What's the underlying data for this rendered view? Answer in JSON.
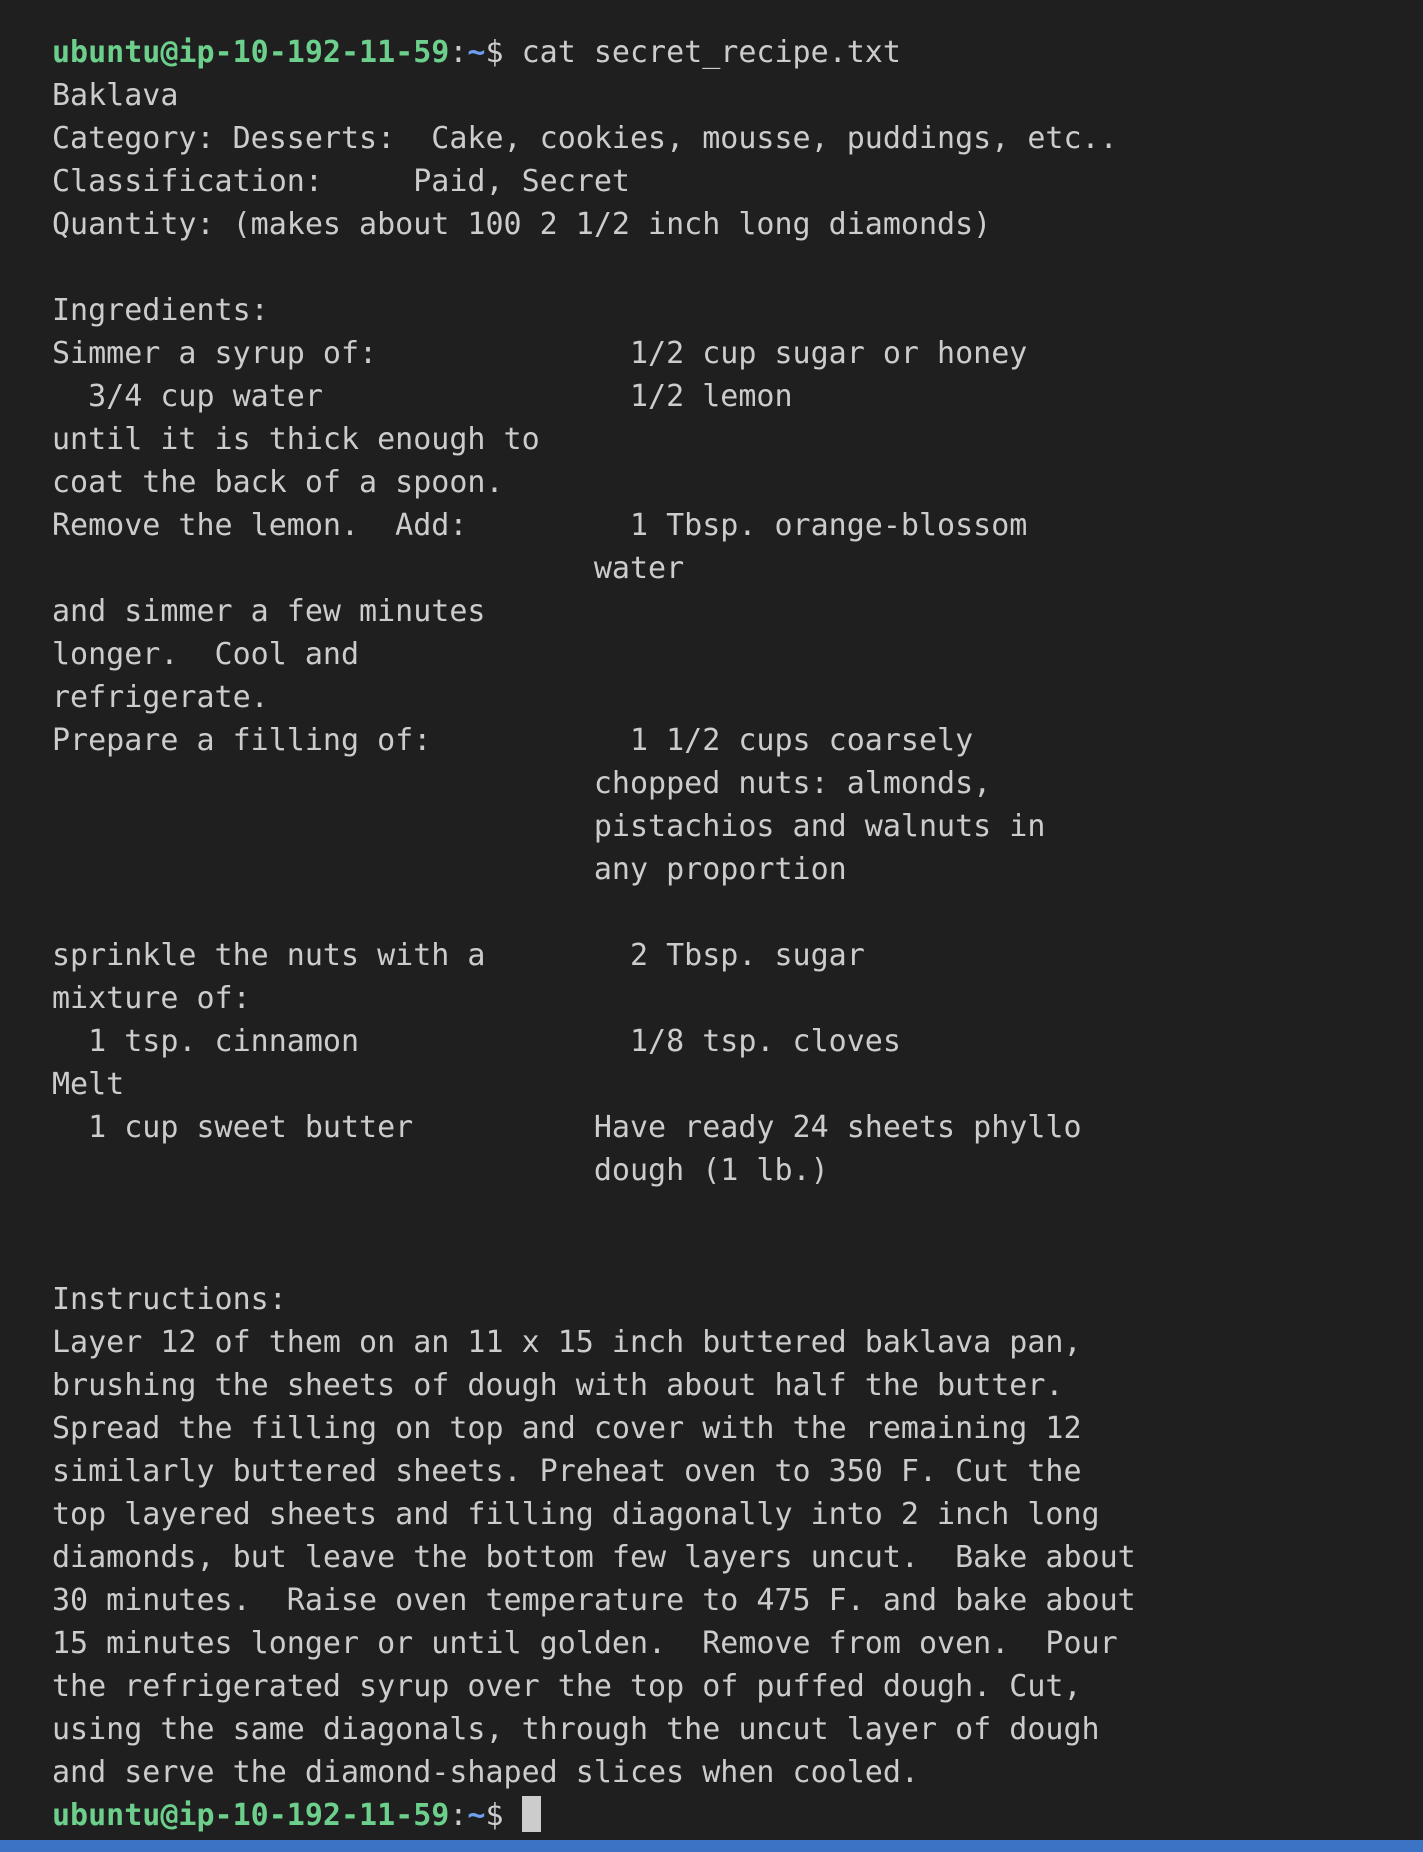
{
  "prompt": {
    "user_host": "ubuntu@ip-10-192-11-59",
    "separator": ":",
    "path": "~",
    "symbol": "$ "
  },
  "command": "cat secret_recipe.txt",
  "output_lines": [
    "Baklava",
    "Category: Desserts:  Cake, cookies, mousse, puddings, etc..",
    "Classification:     Paid, Secret",
    "Quantity: (makes about 100 2 1/2 inch long diamonds)",
    "",
    "Ingredients:",
    "Simmer a syrup of:              1/2 cup sugar or honey",
    "  3/4 cup water                 1/2 lemon",
    "until it is thick enough to",
    "coat the back of a spoon.",
    "Remove the lemon.  Add:         1 Tbsp. orange-blossom",
    "                              water",
    "and simmer a few minutes",
    "longer.  Cool and",
    "refrigerate.",
    "Prepare a filling of:           1 1/2 cups coarsely",
    "                              chopped nuts: almonds,",
    "                              pistachios and walnuts in",
    "                              any proportion",
    "",
    "sprinkle the nuts with a        2 Tbsp. sugar",
    "mixture of:",
    "  1 tsp. cinnamon               1/8 tsp. cloves",
    "Melt",
    "  1 cup sweet butter          Have ready 24 sheets phyllo",
    "                              dough (1 lb.)",
    "",
    "",
    "Instructions:",
    "Layer 12 of them on an 11 x 15 inch buttered baklava pan,",
    "brushing the sheets of dough with about half the butter.",
    "Spread the filling on top and cover with the remaining 12",
    "similarly buttered sheets. Preheat oven to 350 F. Cut the",
    "top layered sheets and filling diagonally into 2 inch long",
    "diamonds, but leave the bottom few layers uncut.  Bake about",
    "30 minutes.  Raise oven temperature to 475 F. and bake about",
    "15 minutes longer or until golden.  Remove from oven.  Pour",
    "the refrigerated syrup over the top of puffed dough. Cut,",
    "using the same diagonals, through the uncut layer of dough",
    "and serve the diamond-shaped slices when cooled."
  ],
  "colors": {
    "background": "#1f1f1f",
    "text": "#cccccc",
    "prompt_user": "#6ccf8b",
    "prompt_path": "#6f9ff0",
    "status_bar": "#3c73c4"
  }
}
